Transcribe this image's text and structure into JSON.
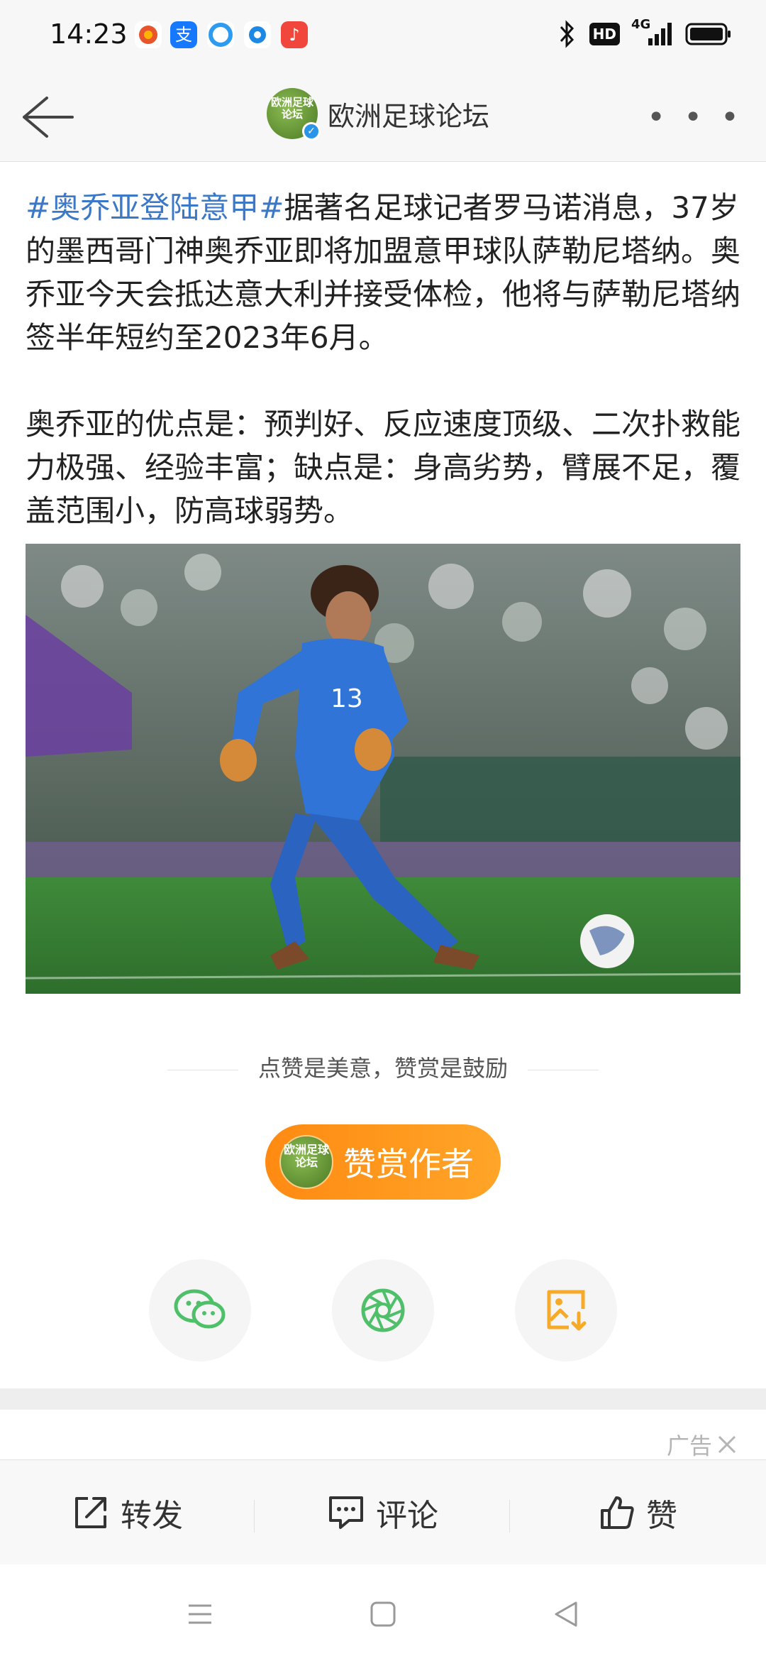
{
  "status": {
    "time": "14:23",
    "network": "4G",
    "hd": "HD"
  },
  "header": {
    "title": "欧洲足球论坛",
    "avatar_text": "欧洲足球论坛",
    "more": "• • •"
  },
  "article": {
    "hashtag": "#奥乔亚登陆意甲#",
    "paragraph1": "据著名足球记者罗马诺消息，37岁的墨西哥门神奥乔亚即将加盟意甲球队萨勒尼塔纳。奥乔亚今天会抵达意大利并接受体检，他将与萨勒尼塔纳签半年短约至2023年6月。",
    "paragraph2": "奥乔亚的优点是：预判好、反应速度顶级、二次扑救能力极强、经验丰富；缺点是：身高劣势，臂展不足，覆盖范围小，防高球弱势。",
    "image_number": "13"
  },
  "reward": {
    "hint": "点赞是美意，赞赏是鼓励",
    "button_label": "赞赏作者"
  },
  "ad": {
    "label": "广告"
  },
  "actions": {
    "forward": "转发",
    "comment": "评论",
    "like": "赞"
  },
  "colors": {
    "hashtag": "#3b78c7",
    "reward_orange": "#ff9a1e",
    "wechat_green": "#4fbf6a",
    "save_orange": "#f7a928"
  }
}
